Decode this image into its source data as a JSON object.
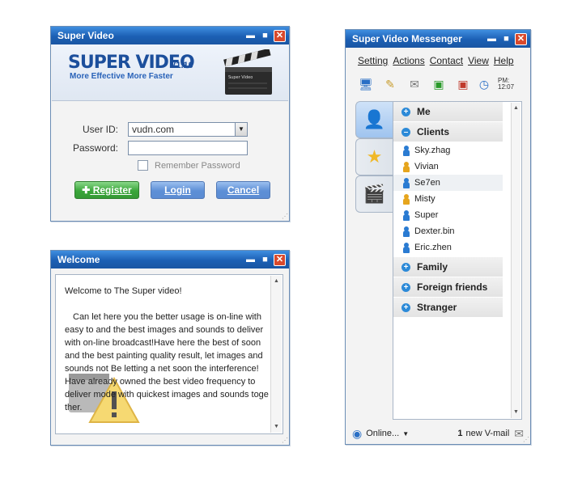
{
  "login": {
    "title": "Super Video",
    "logo": "SUPER VIDEO",
    "version": "V1.10",
    "tagline": "More Effective More Faster",
    "clapper_label": "Super Video",
    "user_id_label": "User ID:",
    "user_id_value": "vudn.com",
    "password_label": "Password:",
    "remember_label": "Remember Password",
    "register": "Register",
    "login": "Login",
    "cancel": "Cancel"
  },
  "welcome": {
    "title": "Welcome",
    "line1": "Welcome to The Super video!",
    "body": "Can let here you the better usage is on-line with easy to and the best images and sounds to deliver with on-line broadcast!Have here the best of soon and the best painting quality result, let images and sounds not Be letting a net soon the interference! Have already owned the best video frequency to deliver mode with quickest images and sounds toge ther."
  },
  "messenger": {
    "title": "Super Video Messenger",
    "menu": [
      "Setting",
      "Actions",
      "Contact",
      "View",
      "Help"
    ],
    "clock": [
      "PM:",
      "12:07"
    ],
    "groups": {
      "me": "Me",
      "clients": "Clients",
      "family": "Family",
      "foreign": "Foreign friends",
      "stranger": "Stranger"
    },
    "contacts": [
      "Sky.zhag",
      "Vivian",
      "Se7en",
      "Misty",
      "Super",
      "Dexter.bin",
      "Eric.zhen"
    ],
    "status": "Online...",
    "vmail_count": "1",
    "vmail_label": "new V-mail"
  },
  "colors": {
    "title_bar": "#1b5fb4",
    "accent": "#2c8ad8",
    "male": "#2a7bd2",
    "female": "#e6a51d"
  }
}
